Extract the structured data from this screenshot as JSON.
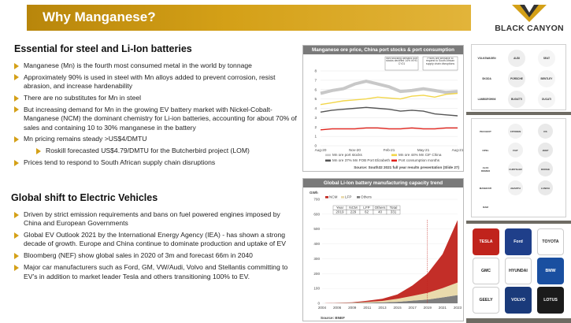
{
  "header": {
    "title": "Why Manganese?",
    "logo_text": "BLACK CANYON"
  },
  "section1": {
    "heading": "Essential for steel and Li-Ion batteries",
    "bullets": [
      {
        "text": "Manganese (Mn) is the fourth most consumed metal in the world by tonnage",
        "sub": false
      },
      {
        "text": "Approximately 90% is used in steel with Mn alloys added to prevent corrosion, resist abrasion, and increase hardenability",
        "sub": false
      },
      {
        "text": "There are no substitutes for Mn in steel",
        "sub": false
      },
      {
        "text": "But increasing demand for Mn in the growing EV battery market with Nickel-Cobalt-Manganese (NCM) the dominant chemistry for Li-ion batteries, accounting for about 70% of sales and containing 10 to 30% manganese in the battery",
        "sub": false
      },
      {
        "text": "Mn pricing remains steady >US$4/DMTU",
        "sub": false
      },
      {
        "text": "Roskill forecasted US$4.79/DMTU for the Butcherbird project (LOM)",
        "sub": true
      },
      {
        "text": "Prices tend to respond to South African supply chain disruptions",
        "sub": false
      }
    ]
  },
  "section2": {
    "heading": "Global shift to Electric Vehicles",
    "bullets": [
      {
        "text": "Driven by strict emission requirements and bans on fuel powered engines imposed by China and European Governments"
      },
      {
        "text": "Global EV Outlook 2021 by the International Energy Agency (IEA) -  has shown a strong decade of growth. Europe and China continue to dominate production and uptake of EV"
      },
      {
        "text": "Bloomberg (NEF) show global sales in 2020 of 3m and forecast 66m in 2040"
      },
      {
        "text": "Major car manufacturers such as Ford, GM, VW/Audi, Volvo and Stellantis committing to EV’s in addition to market leader Tesla and others transitioning 100% to EV."
      }
    ]
  },
  "chart_data": [
    {
      "type": "line",
      "title": "Manganese ore price, China port stocks & port consumption",
      "x": [
        "Aug-20",
        "Nov-20",
        "Feb-21",
        "May-21",
        "Aug-21"
      ],
      "ylim": [
        0,
        8
      ],
      "yticks": [
        "0",
        "1",
        "2",
        "3",
        "4",
        "5",
        "6",
        "7",
        "8"
      ],
      "annotations": [
        "Well stocking demand port stocks declined 14% in H1 CY21",
        "Prices are sensitive to request to South African supply chain disruptions"
      ],
      "series": [
        {
          "name": "Mn ore port stocks",
          "color": "#c8c8c8",
          "values": [
            5.6,
            5.9,
            6.1,
            6.6,
            6.9,
            6.6,
            6.3,
            5.8,
            5.9,
            6.1,
            5.9,
            5.7,
            5.8
          ]
        },
        {
          "name": "Mn ore 44% Mn CIF China",
          "color": "#f2d64a",
          "values": [
            4.4,
            4.6,
            4.8,
            4.9,
            5.0,
            5.2,
            5.1,
            5.0,
            5.3,
            5.4,
            5.2,
            5.5,
            5.6
          ]
        },
        {
          "name": "Mn ore 37% Mn FOB Port Elizabeth",
          "color": "#555555",
          "values": [
            3.6,
            3.8,
            3.9,
            4.0,
            4.1,
            4.0,
            3.9,
            3.7,
            3.8,
            3.7,
            3.4,
            3.3,
            3.2
          ]
        },
        {
          "name": "Port consumption months",
          "color": "#e0231c",
          "values": [
            1.7,
            1.8,
            1.8,
            1.8,
            1.9,
            1.9,
            1.8,
            1.8,
            1.9,
            1.8,
            1.8,
            1.9,
            1.9
          ]
        }
      ],
      "source": "Source: South32 2021 full year results presentation (Slide 27)"
    },
    {
      "type": "area",
      "title": "Global Li-Ion battery manufacturing capacity trend",
      "ylabel": "GWh",
      "x": [
        "2004",
        "2006",
        "2009",
        "2011",
        "2013",
        "2015",
        "2017",
        "2019",
        "2021",
        "2023"
      ],
      "ylim": [
        0,
        700
      ],
      "yticks": [
        "0",
        "100",
        "200",
        "300",
        "400",
        "500",
        "600",
        "700"
      ],
      "series": [
        {
          "name": "NCM",
          "color": "#c0231c",
          "values": [
            0,
            1,
            3,
            8,
            15,
            30,
            70,
            130,
            229,
            420
          ]
        },
        {
          "name": "LFP",
          "color": "#e8d8a8",
          "values": [
            0,
            1,
            2,
            5,
            10,
            20,
            32,
            45,
            62,
            85
          ]
        },
        {
          "name": "Others",
          "color": "#777777",
          "values": [
            0,
            1,
            2,
            4,
            6,
            10,
            18,
            25,
            40,
            55
          ]
        }
      ],
      "table": {
        "headers": [
          "Year",
          "NCM",
          "LFP",
          "Others",
          "Total"
        ],
        "row": [
          "2019",
          "229",
          "62",
          "40",
          "331"
        ]
      },
      "source": "Source: BNEF"
    }
  ],
  "logo_column": {
    "group1": [
      "VOLKSWAGEN",
      "AUDI",
      "SEAT",
      "SKODA",
      "PORSCHE",
      "BENTLEY",
      "LAMBORGHINI",
      "BUGATTI",
      "DUCATI"
    ],
    "group2": [
      "PEUGEOT",
      "CITROEN",
      "DS",
      "OPEL",
      "FIAT",
      "JEEP",
      "ALFA ROMEO",
      "CHRYSLER",
      "DODGE",
      "MASERATI",
      "ABARTH",
      "LANCIA",
      "RAM"
    ],
    "group3": [
      "TESLA",
      "Ford",
      "TOYOTA",
      "GMC",
      "HYUNDAI",
      "BMW",
      "GEELY",
      "VOLVO",
      "LOTUS"
    ]
  }
}
